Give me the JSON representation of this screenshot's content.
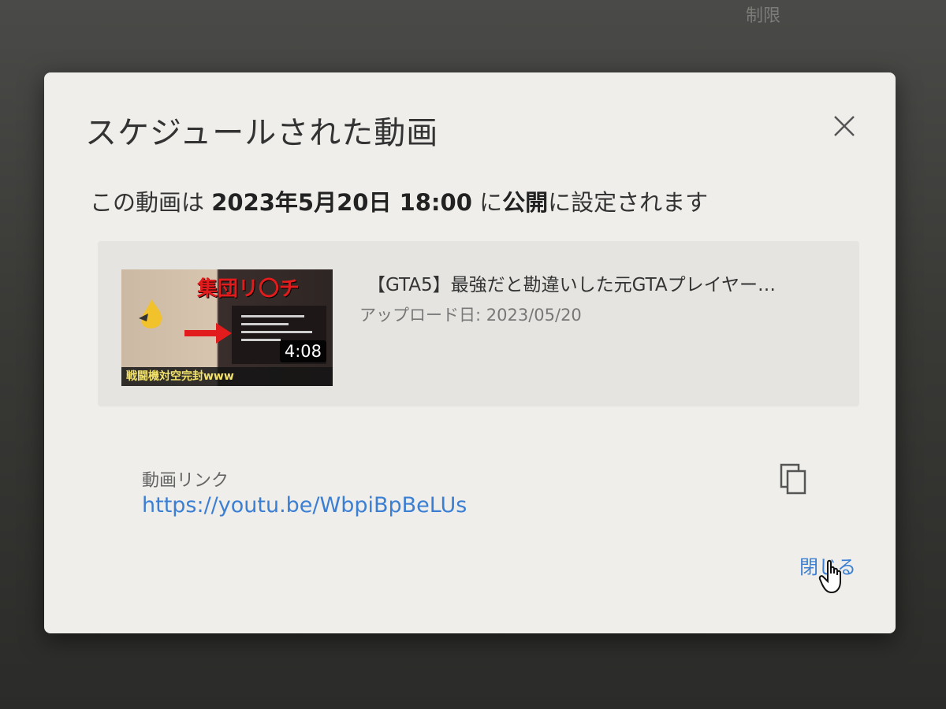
{
  "background": {
    "top_label": "制限"
  },
  "dialog": {
    "title": "スケジュールされた動画",
    "schedule": {
      "prefix": "この動画は ",
      "datetime": "2023年5月20日 18:00",
      "middle": " に",
      "visibility": "公開",
      "suffix": "に設定されます"
    },
    "video": {
      "thumbnail_title": "集団リ〇チ",
      "thumbnail_caption": "戦闘機対空完封www",
      "duration": "4:08",
      "title": "【GTA5】最強だと勘違いした元GTAプレイヤー…",
      "upload_date": "アップロード日: 2023/05/20"
    },
    "link": {
      "label": "動画リンク",
      "url": "https://youtu.be/WbpiBpBeLUs"
    },
    "close_label": "閉じる"
  },
  "colors": {
    "accent": "#3b7fd4",
    "dialog_bg": "#efeeea",
    "card_bg": "#e5e4e0"
  },
  "icons": {
    "close": "close-icon",
    "copy": "copy-icon",
    "cursor": "hand-pointer-icon"
  }
}
